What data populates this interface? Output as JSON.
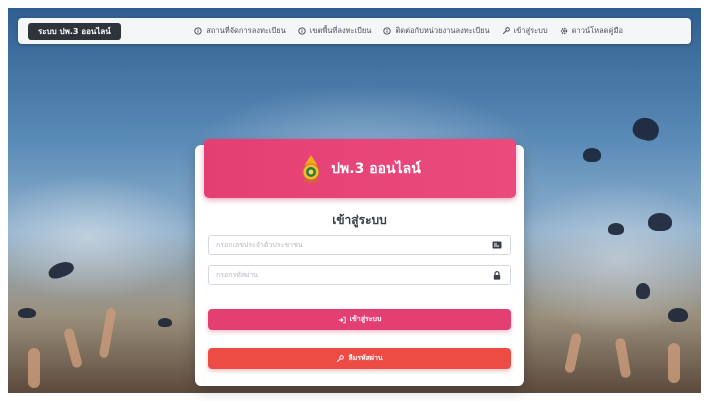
{
  "nav": {
    "brand": "ระบบ ปพ.3 ออนไลน์",
    "items": [
      {
        "label": "สถานที่จัดการลงทะเบียน",
        "icon": "info-circle-icon"
      },
      {
        "label": "เขตพื้นที่ลงทะเบียน",
        "icon": "info-circle-icon"
      },
      {
        "label": "ติดต่อกับหน่วยงานลงทะเบียน",
        "icon": "info-circle-icon"
      },
      {
        "label": "เข้าสู่ระบบ",
        "icon": "key-icon"
      },
      {
        "label": "ดาวน์โหลดคู่มือ",
        "icon": "gear-icon"
      }
    ]
  },
  "card": {
    "title": "ปพ.3 ออนไลน์",
    "login_heading": "เข้าสู่ระบบ",
    "id_placeholder": "กรอกเลขประจำตัวประชาชน",
    "password_placeholder": "กรอกรหัสผ่าน",
    "login_button": "เข้าสู่ระบบ",
    "forgot_button": "ลืมรหัสผ่าน"
  },
  "colors": {
    "accent": "#e43f73",
    "danger": "#ec4c44",
    "brand_bg": "#2f333a"
  }
}
